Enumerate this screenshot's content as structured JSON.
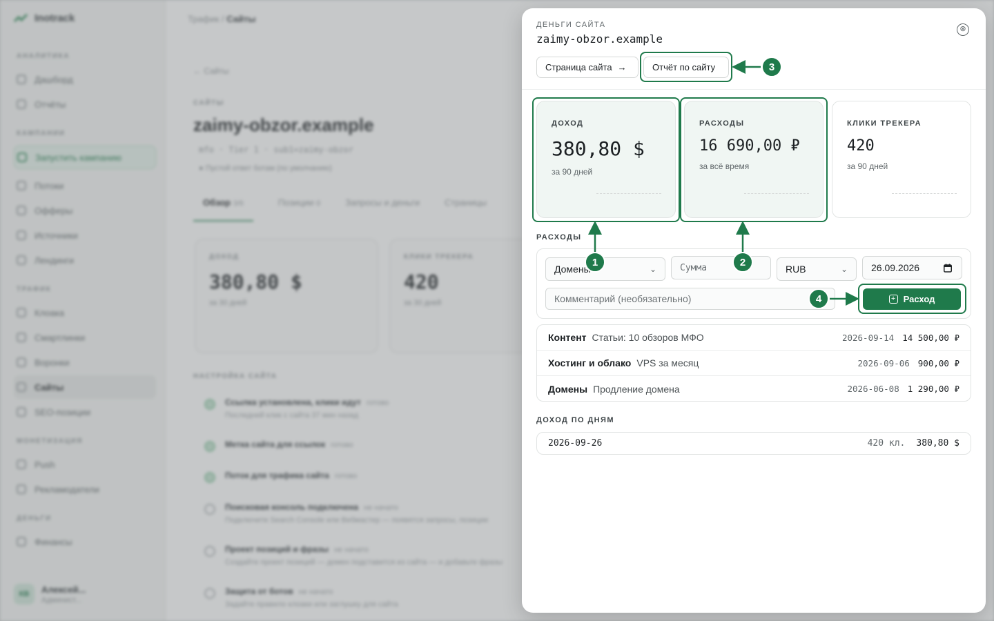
{
  "background": {
    "brand": "Inotrack",
    "sidebar": {
      "sections": [
        {
          "title": "АНАЛИТИКА",
          "items": [
            "Дашборд",
            "Отчёты"
          ]
        },
        {
          "title": "КАМПАНИИ",
          "items": [
            "Запустить кампанию",
            "Потоки",
            "Офферы",
            "Источники",
            "Лендинги"
          ]
        },
        {
          "title": "ТРАФИК",
          "items": [
            "Клоака",
            "Смартлинки",
            "Воронки",
            "Сайты",
            "SEO-позиции"
          ]
        },
        {
          "title": "МОНЕТИЗАЦИЯ",
          "items": [
            "Push",
            "Рекламодатели"
          ]
        },
        {
          "title": "ДЕНЬГИ",
          "items": [
            "Финансы"
          ]
        }
      ],
      "user": {
        "initials": "КВ",
        "name": "Алексей...",
        "role": "Админист..."
      }
    },
    "breadcrumb": {
      "parent": "Трафик",
      "sep": "/",
      "current": "Сайты"
    },
    "back": "← Сайты",
    "kicker": "САЙТЫ",
    "title": "zaimy-obzor.example",
    "meta": "mfo · Tier 1 · sub1=zaimy-obzor",
    "status": "● Пустой ответ ботам (по умолчанию)",
    "tabs": [
      {
        "label": "Обзор",
        "count": "3/6"
      },
      {
        "label": "Позиции",
        "count": "0"
      },
      {
        "label": "Запросы и деньги",
        "count": ""
      },
      {
        "label": "Страницы",
        "count": ""
      }
    ],
    "cards": [
      {
        "label": "ДОХОД",
        "value": "380,80 $",
        "sub": "за 30 дней"
      },
      {
        "label": "КЛИКИ ТРЕКЕРА",
        "value": "420",
        "sub": "за 30 дней"
      }
    ],
    "setup_title": "НАСТРОЙКА САЙТА",
    "setup": [
      {
        "title": "Ссылка установлена, клики идут",
        "state": "готово",
        "desc": "Последний клик с сайта 37 мин назад",
        "done": true
      },
      {
        "title": "Метка сайта для ссылок",
        "state": "готово",
        "desc": "",
        "done": true
      },
      {
        "title": "Поток для трафика сайта",
        "state": "готово",
        "desc": "",
        "done": true
      },
      {
        "title": "Поисковая консоль подключена",
        "state": "не начато",
        "desc": "Подключите Search Console или Вебмастер — появятся запросы, позиции",
        "done": false
      },
      {
        "title": "Проект позиций и фразы",
        "state": "не начато",
        "desc": "Создайте проект позиций — домен подставится из сайта — и добавьте фразы",
        "done": false
      },
      {
        "title": "Защита от ботов",
        "state": "не начато",
        "desc": "Задайте правило клоаки или заглушку для сайта",
        "done": false
      }
    ]
  },
  "modal": {
    "kicker": "ДЕНЬГИ САЙТА",
    "title": "zaimy-obzor.example",
    "close_icon": "⊗",
    "buttons": {
      "site_page": "Страница сайта",
      "site_page_arrow": "→",
      "report": "Отчёт по сайту"
    },
    "stats": [
      {
        "label": "ДОХОД",
        "value": "380,80 $",
        "sub": "за 90 дней"
      },
      {
        "label": "РАСХОДЫ",
        "value": "16 690,00 ₽",
        "sub": "за всё время"
      },
      {
        "label": "КЛИКИ ТРЕКЕРА",
        "value": "420",
        "sub": "за 90 дней"
      }
    ],
    "expenses_label": "РАСХОДЫ",
    "form": {
      "category": "Домены",
      "amount_placeholder": "Сумма",
      "currency": "RUB",
      "date": "26.09.2026",
      "comment_placeholder": "Комментарий (необязательно)",
      "submit": "Расход"
    },
    "expenses": [
      {
        "category": "Контент",
        "desc": "Статьи: 10 обзоров МФО",
        "date": "2026-09-14",
        "amount": "14 500,00 ₽"
      },
      {
        "category": "Хостинг и облако",
        "desc": "VPS за месяц",
        "date": "2026-09-06",
        "amount": "900,00 ₽"
      },
      {
        "category": "Домены",
        "desc": "Продление домена",
        "date": "2026-06-08",
        "amount": "1 290,00 ₽"
      }
    ],
    "income_label": "ДОХОД ПО ДНЯМ",
    "income": [
      {
        "date": "2026-09-26",
        "clicks": "420 кл.",
        "amount": "380,80 $"
      }
    ]
  },
  "annotations": {
    "badges": [
      "1",
      "2",
      "3",
      "4"
    ],
    "color": "#1f7a4b"
  }
}
